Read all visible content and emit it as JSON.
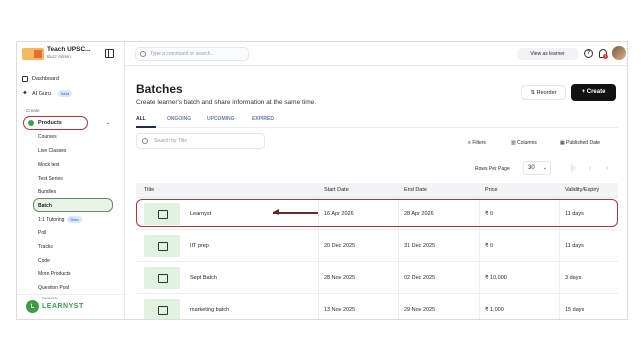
{
  "org": {
    "name": "Teach UPSC...",
    "role": "Buzz Admin"
  },
  "sidebar": {
    "dashboard": "Dashboard",
    "ai_guru": "AI Guru",
    "ai_badge": "Beta",
    "section_create": "Create",
    "products": "Products",
    "sub_items": [
      "Courses",
      "Live Classes",
      "Mock test",
      "Test Series",
      "Bundles",
      "Batch",
      "1:1 Tutoring",
      "Poll",
      "Tracks",
      "Code",
      "More Products",
      "Question Pool"
    ],
    "tutoring_badge": "Beta",
    "brand_powered": "Powered by",
    "brand": "LEARNYST"
  },
  "topbar": {
    "search_placeholder": "Type a command or search...",
    "view_as_learner": "View as learner",
    "notif_count": "1"
  },
  "main": {
    "title": "Batches",
    "subtitle": "Create learner's batch and share information at the same time.",
    "reorder": "Reorder",
    "create": "Create",
    "tabs": [
      "ALL",
      "ONGOING",
      "UPCOMING",
      "EXPIRED"
    ],
    "search_placeholder": "Search by Title",
    "filters": "Filters",
    "columns": "Columns",
    "published_date": "Published Date",
    "rows_per_page_label": "Rows Per Page",
    "rows_per_page": "30"
  },
  "table": {
    "headers": [
      "Title",
      "Start Date",
      "End Date",
      "Price",
      "Validity/Expiry"
    ],
    "rows": [
      {
        "title": "Learnyst",
        "start": "16 Apr 2026",
        "end": "28 Apr 2026",
        "price": "₹ 0",
        "validity": "11 days"
      },
      {
        "title": "IIT prep",
        "start": "20 Dec 2025",
        "end": "31 Dec 2025",
        "price": "₹ 0",
        "validity": "11 days"
      },
      {
        "title": "Sept Batch",
        "start": "28 Nov 2025",
        "end": "02 Dec 2025",
        "price": "₹ 10,000",
        "validity": "3 days"
      },
      {
        "title": "marketing batch",
        "start": "13 Nov 2025",
        "end": "29 Nov 2025",
        "price": "₹ 1,000",
        "validity": "15 days"
      }
    ]
  },
  "colors": {
    "accent": "#111111",
    "highlight": "#a63a3a",
    "brand": "#3f9a4a"
  }
}
